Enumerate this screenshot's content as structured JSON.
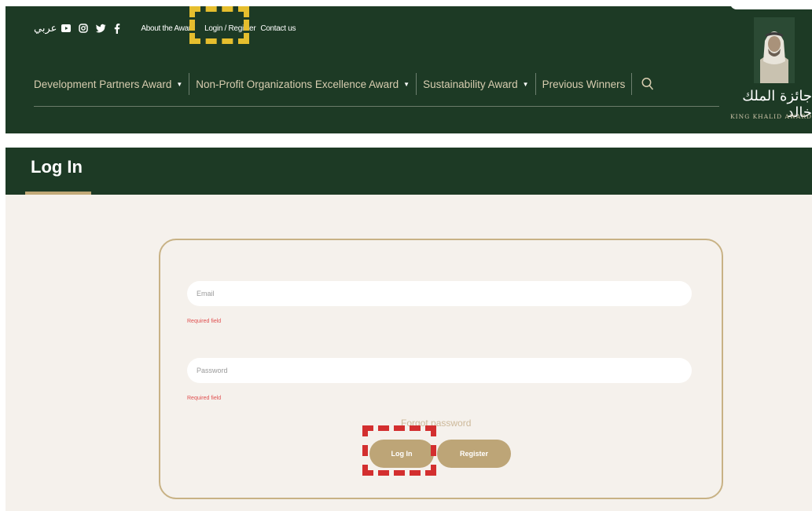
{
  "header": {
    "language_link": "عربي",
    "social_icons": [
      "youtube-icon",
      "instagram-icon",
      "twitter-icon",
      "facebook-icon"
    ],
    "top_links": {
      "about": "About the Award",
      "login_register": "Login / Register",
      "contact": "Contact us"
    },
    "nav": [
      {
        "label": "Development Partners Award",
        "has_dropdown": true
      },
      {
        "label": "Non-Profit Organizations Excellence Award",
        "has_dropdown": true
      },
      {
        "label": "Sustainability Award",
        "has_dropdown": true
      },
      {
        "label": "Previous Winners",
        "has_dropdown": false
      }
    ],
    "logo": {
      "arabic": "جائزة الملك خالد",
      "english": "KING KHALID AWARD"
    }
  },
  "page": {
    "title": "Log In"
  },
  "form": {
    "email_placeholder": "Email",
    "email_error": "Required field",
    "password_placeholder": "Password",
    "password_error": "Required field",
    "forgot_label": "Forgot password",
    "login_label": "Log In",
    "register_label": "Register"
  },
  "colors": {
    "header_bg": "#1d3a25",
    "accent_gold": "#bda577",
    "content_bg": "#f5f1ec",
    "error_red": "#e05050",
    "highlight_yellow": "#e6be2e",
    "highlight_red": "#d32f2f"
  }
}
